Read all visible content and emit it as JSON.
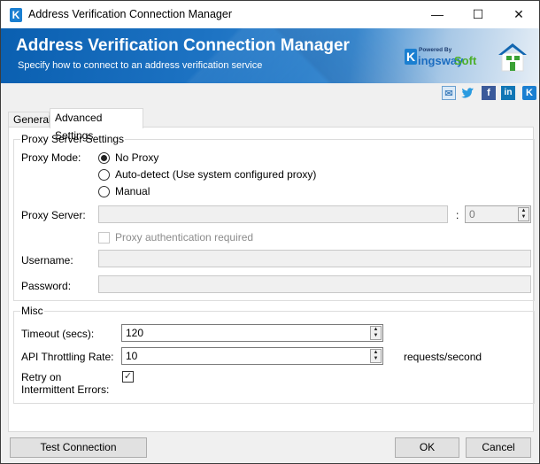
{
  "window": {
    "title": "Address Verification Connection Manager",
    "app_icon": "K",
    "controls": {
      "minimize": "—",
      "maximize": "☐",
      "close": "✕"
    }
  },
  "banner": {
    "title": "Address Verification Connection Manager",
    "subtitle": "Specify how to connect to an address verification service",
    "logo": {
      "k": "K",
      "powered_by": "Powered By",
      "name_part1": "ingsway",
      "name_part2": "Soft"
    }
  },
  "social_icons": [
    "mail-icon",
    "twitter-icon",
    "facebook-icon",
    "linkedin-icon",
    "kingswaysoft-icon"
  ],
  "social_glyphs": {
    "mail": "✉",
    "twitter": "🐦",
    "facebook": "f",
    "linkedin": "in",
    "kingswaysoft": "K"
  },
  "tabs": [
    {
      "label": "General",
      "active": false
    },
    {
      "label": "Advanced Settings",
      "active": true
    }
  ],
  "proxy": {
    "group_title": "Proxy Server Settings",
    "mode_label": "Proxy Mode:",
    "modes": [
      {
        "label": "No Proxy",
        "selected": true
      },
      {
        "label": "Auto-detect (Use system configured proxy)",
        "selected": false
      },
      {
        "label": "Manual",
        "selected": false
      }
    ],
    "server_label": "Proxy Server:",
    "server_value": "",
    "port_separator": ":",
    "port_value": "0",
    "auth_label": "Proxy authentication required",
    "auth_checked": false,
    "username_label": "Username:",
    "username_value": "",
    "password_label": "Password:",
    "password_value": ""
  },
  "misc": {
    "group_title": "Misc",
    "timeout_label": "Timeout (secs):",
    "timeout_value": "120",
    "throttle_label": "API Throttling Rate:",
    "throttle_value": "10",
    "throttle_unit": "requests/second",
    "retry_label_line1": "Retry on",
    "retry_label_line2": "Intermittent Errors:",
    "retry_checked": true,
    "check_glyph": "✓"
  },
  "buttons": {
    "test_connection": "Test Connection",
    "ok": "OK",
    "cancel": "Cancel"
  },
  "spin_glyphs": {
    "up": "▲",
    "down": "▼"
  }
}
